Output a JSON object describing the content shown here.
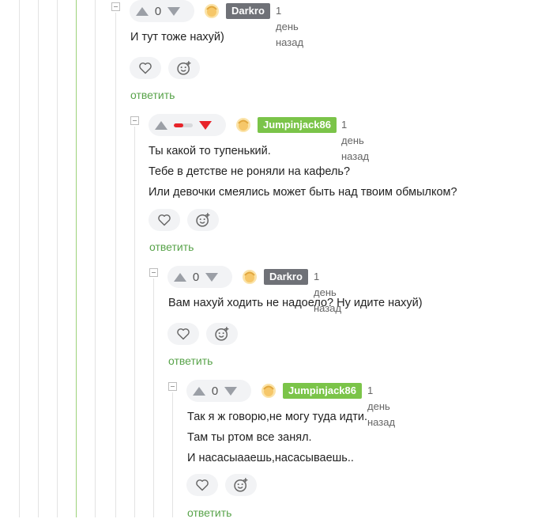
{
  "comments": [
    {
      "rating": "0",
      "nick": "Darkro",
      "time": "1 день назад",
      "lines": [
        "И тут тоже нахуй)"
      ],
      "reply": "ответить"
    },
    {
      "rating_fraction_negative": 0.5,
      "nick": "Jumpinjack86",
      "time": "1 день назад",
      "lines": [
        "Ты какой то тупенький.",
        "Тебе в детстве не роняли на кафель?",
        "Или девочки смеялись может быть над твоим обмылком?"
      ],
      "reply": "ответить"
    },
    {
      "rating": "0",
      "nick": "Darkro",
      "time": "1 день назад",
      "lines": [
        "Вам нахуй ходить не надоело? Ну идите нахуй)"
      ],
      "reply": "ответить"
    },
    {
      "rating": "0",
      "nick": "Jumpinjack86",
      "time": "1 день назад",
      "lines": [
        "Так я ж говорю,не могу туда идти.",
        "Там ты ртом все занял.",
        "И насасыааешь,насасываешь.."
      ],
      "reply": "ответить"
    }
  ],
  "colors": {
    "nick_gray": "#6f7177",
    "nick_green": "#7bc449",
    "reply_green": "#58a34a",
    "downvote_red": "#e8242a",
    "thread_line": "#e3e3e3",
    "thread_line_active": "#9dd27a"
  },
  "icons": {
    "upvote": "triangle-up-icon",
    "downvote": "triangle-down-icon",
    "like": "heart-icon",
    "react": "smiley-plus-icon",
    "avatar": "default-avatar-icon",
    "collapse": "minus-square-icon"
  }
}
